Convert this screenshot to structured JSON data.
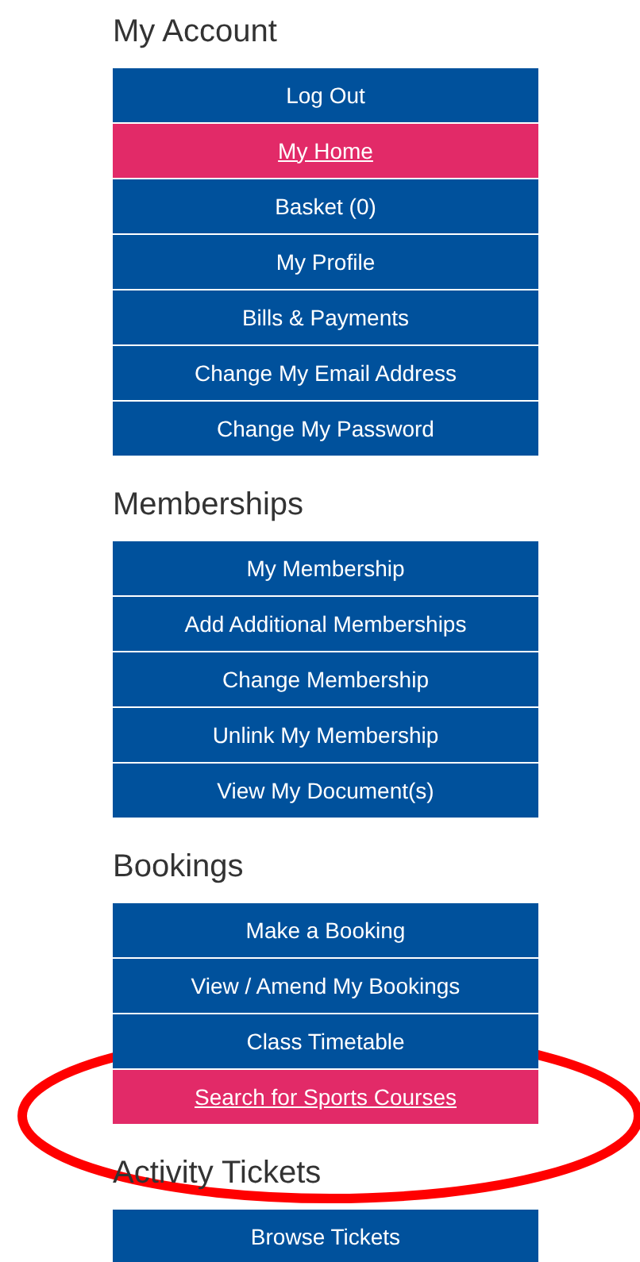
{
  "sections": [
    {
      "heading": "My Account",
      "items": [
        {
          "label": "Log Out",
          "selected": false
        },
        {
          "label": "My Home",
          "selected": true
        },
        {
          "label": "Basket (0)",
          "selected": false
        },
        {
          "label": "My Profile",
          "selected": false
        },
        {
          "label": "Bills & Payments",
          "selected": false
        },
        {
          "label": "Change My Email Address",
          "selected": false
        },
        {
          "label": "Change My Password",
          "selected": false
        }
      ]
    },
    {
      "heading": "Memberships",
      "items": [
        {
          "label": "My Membership",
          "selected": false
        },
        {
          "label": "Add Additional Memberships",
          "selected": false
        },
        {
          "label": "Change Membership",
          "selected": false
        },
        {
          "label": "Unlink My Membership",
          "selected": false
        },
        {
          "label": "View My Document(s)",
          "selected": false
        }
      ]
    },
    {
      "heading": "Bookings",
      "items": [
        {
          "label": "Make a Booking",
          "selected": false
        },
        {
          "label": "View / Amend My Bookings",
          "selected": false
        },
        {
          "label": "Class Timetable",
          "selected": false
        },
        {
          "label": "Search for Sports Courses",
          "selected": true
        }
      ]
    },
    {
      "heading": "Activity Tickets",
      "items": [
        {
          "label": "Browse Tickets",
          "selected": false
        }
      ]
    }
  ]
}
